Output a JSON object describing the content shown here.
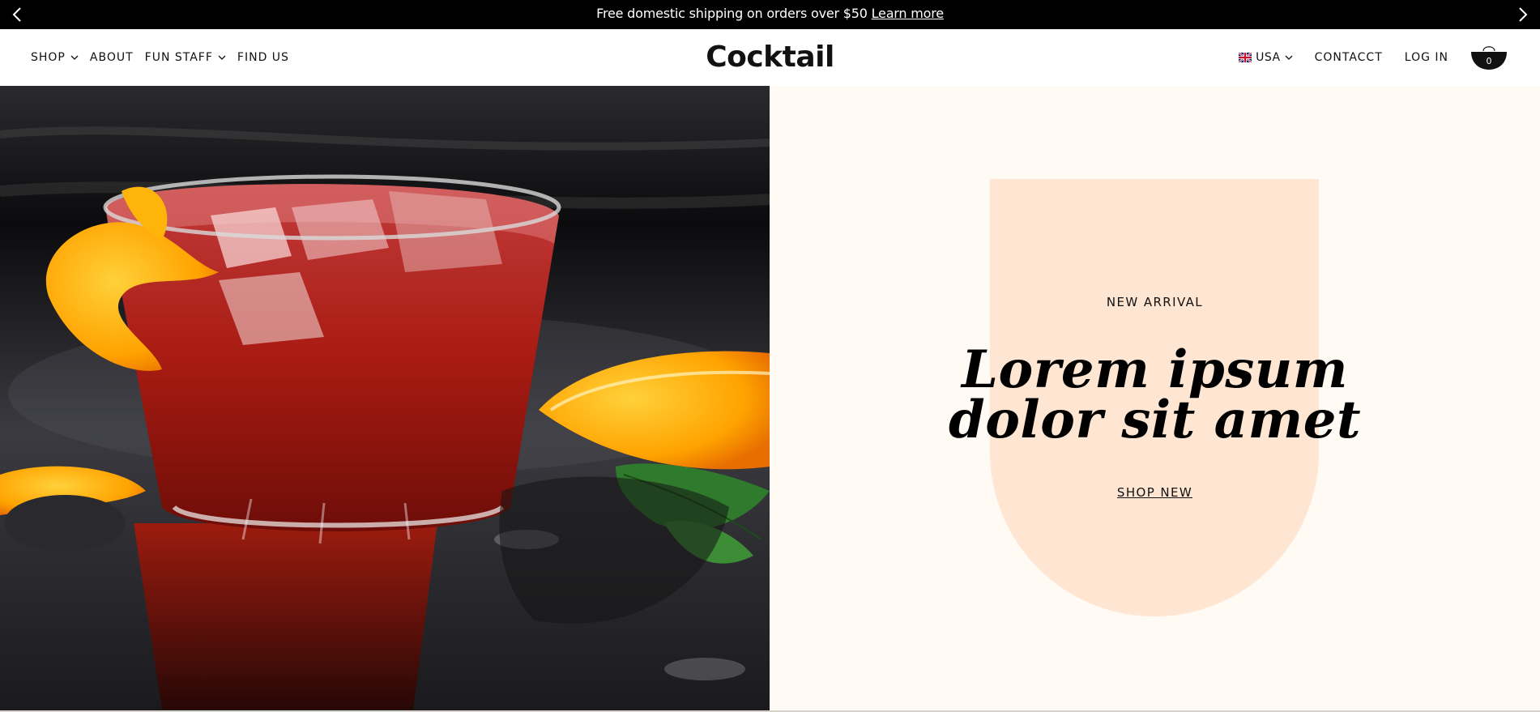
{
  "announcement": {
    "text": "Free domestic shipping on orders over $50",
    "link": "Learn more",
    "prev_icon": "chevron-left-icon",
    "next_icon": "chevron-right-icon"
  },
  "nav": {
    "left": [
      {
        "label": "SHOP",
        "dropdown": true
      },
      {
        "label": "ABOUT",
        "dropdown": false
      },
      {
        "label": "FUN STAFF",
        "dropdown": true
      },
      {
        "label": "FIND US",
        "dropdown": false
      }
    ],
    "logo": "Cocktail",
    "country": {
      "label": "USA",
      "flag_icon": "uk-flag-icon"
    },
    "contact": "CONTACCT",
    "login": "LOG IN",
    "cart": {
      "icon": "cart-bowl-icon",
      "count": "0"
    }
  },
  "hero": {
    "eyebrow": "NEW ARRIVAL",
    "headline_line1": "Lorem ipsum",
    "headline_line2": "dolor sit amet",
    "cta": "SHOP NEW",
    "image": "cocktail-negroni-photo"
  },
  "colors": {
    "announcement_bg": "#000000",
    "panel_bg": "#fffaf4",
    "arch": "#ffe6d3",
    "text": "#111111"
  }
}
